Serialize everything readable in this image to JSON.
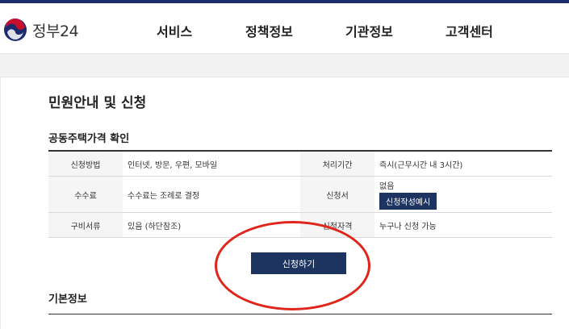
{
  "header": {
    "logo_text": "정부24",
    "nav": [
      "서비스",
      "정책정보",
      "기관정보",
      "고객센터"
    ]
  },
  "page": {
    "title": "민원안내 및 신청",
    "section_title": "공동주택가격 확인",
    "basic_title": "기본정보"
  },
  "table": {
    "rows": [
      {
        "h1": "신청방법",
        "v1": "인터넷, 방문, 우편, 모바일",
        "h2": "처리기간",
        "v2": "즉시(근무시간 내 3시간)"
      },
      {
        "h1": "수수료",
        "v1": "수수료는 조례로 결정",
        "h2": "신청서",
        "v2": "없음",
        "v2_button": "신청작성예시"
      },
      {
        "h1": "구비서류",
        "v1": "있음 (하단참조)",
        "h2": "신청자격",
        "v2": "누구나 신청 가능"
      }
    ]
  },
  "apply_button": "신청하기",
  "colors": {
    "brand_navy": "#1d3461",
    "highlight_red": "#e0261b",
    "topbar": "#1b2b6e"
  }
}
